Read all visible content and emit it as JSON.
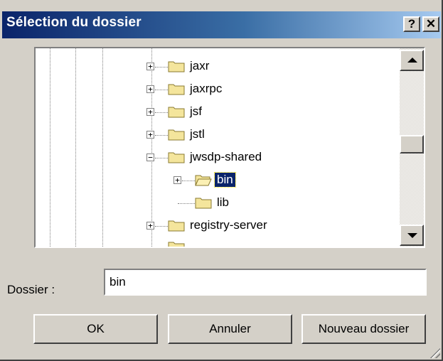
{
  "window": {
    "title": "Sélection du dossier",
    "help_label": "?",
    "close_label": "✕"
  },
  "tree": {
    "items": [
      {
        "label": "jaxr",
        "expander": "+",
        "selected": false
      },
      {
        "label": "jaxrpc",
        "expander": "+",
        "selected": false
      },
      {
        "label": "jsf",
        "expander": "+",
        "selected": false
      },
      {
        "label": "jstl",
        "expander": "+",
        "selected": false
      },
      {
        "label": "jwsdp-shared",
        "expander": "−",
        "selected": false
      },
      {
        "label": "bin",
        "expander": "+",
        "selected": true
      },
      {
        "label": "lib",
        "expander": "",
        "selected": false
      },
      {
        "label": "registry-server",
        "expander": "+",
        "selected": false
      }
    ]
  },
  "folder_field": {
    "label": "Dossier :",
    "value": "bin"
  },
  "buttons": {
    "ok": "OK",
    "cancel": "Annuler",
    "new_folder": "Nouveau dossier"
  },
  "colors": {
    "titlebar_start": "#0a246a",
    "titlebar_end": "#a6caf0",
    "selection": "#0a246a",
    "face": "#d4d0c8",
    "folder": "#f4e59c"
  }
}
